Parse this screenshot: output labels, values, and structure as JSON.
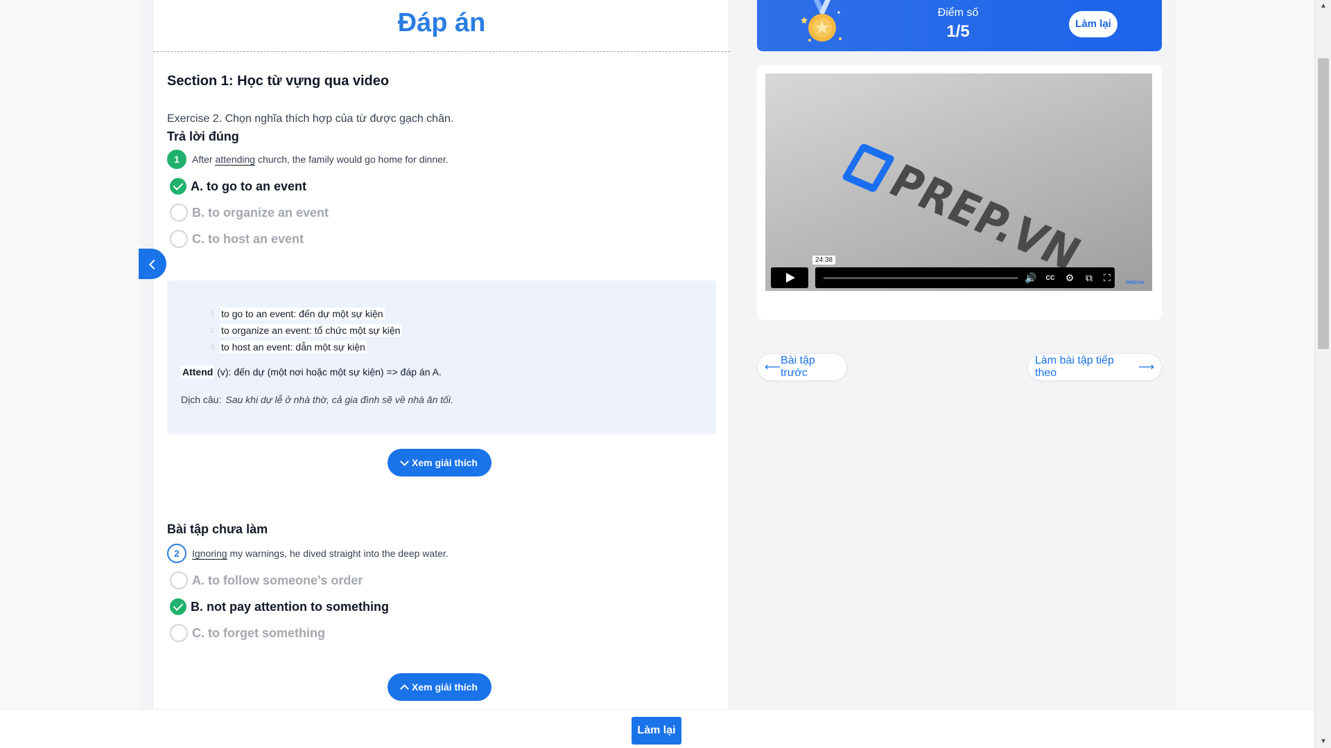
{
  "page": {
    "title": "Đáp án"
  },
  "section": {
    "title": "Section 1: Học từ vựng qua video",
    "exercise": "Exercise 2. Chọn nghĩa thích hợp của từ được gạch chân."
  },
  "answered_group": {
    "title": "Trả lời đúng",
    "question": {
      "number": "1",
      "before": "After ",
      "underlined": "attending",
      "after": " church, the family would go home for dinner.",
      "options": [
        {
          "label": "A. to go to an event",
          "state": "selected-correct"
        },
        {
          "label": "B. to organize an event",
          "state": "unselected"
        },
        {
          "label": "C. to host an event",
          "state": "unselected"
        }
      ]
    },
    "explanation": {
      "items": [
        {
          "num": "1",
          "text": "to go to an event: đến dự một sự kiện"
        },
        {
          "num": "2",
          "text": "to organize an event: tổ chức một sự kiện"
        },
        {
          "num": "3",
          "text": "to host an event: dẫn một sự kiện"
        }
      ],
      "attend_bold": "Attend",
      "attend_rest": " (v): đến dự (một nơi hoặc một sự kiện) => đáp án A.",
      "translation_label": "Dịch câu:",
      "translation_text": "Sau khi dự lễ ở nhà thờ, cả gia đình sẽ về nhà ăn tối."
    },
    "toggle_label": "Xem giải thích"
  },
  "pending_group": {
    "title": "Bài tập chưa làm",
    "question": {
      "number": "2",
      "underlined": "Ignoring",
      "after": " my warnings, he dived straight into the deep water.",
      "options": [
        {
          "label": "A. to follow someone’s order",
          "state": "unselected"
        },
        {
          "label": "B. not pay attention to something",
          "state": "correct"
        },
        {
          "label": "C. to forget something",
          "state": "unselected"
        }
      ]
    },
    "toggle_label": "Xem giải thích"
  },
  "score": {
    "label": "Điểm số",
    "value": "1/5",
    "retry_label": "Làm lại"
  },
  "video": {
    "logo_text": "PREP.VN",
    "timestamp": "24:38",
    "corner_text": "PREP.VN"
  },
  "navigation": {
    "prev_label": "Bài tập trước",
    "next_label": "Làm bài tập tiếp theo"
  },
  "bottom_bar": {
    "retry_label": "Làm lại"
  },
  "colors": {
    "accent": "#1a73e8",
    "title_blue": "#2a7de1",
    "correct_green": "#20b26c",
    "explanation_bg": "#eef2fd"
  }
}
